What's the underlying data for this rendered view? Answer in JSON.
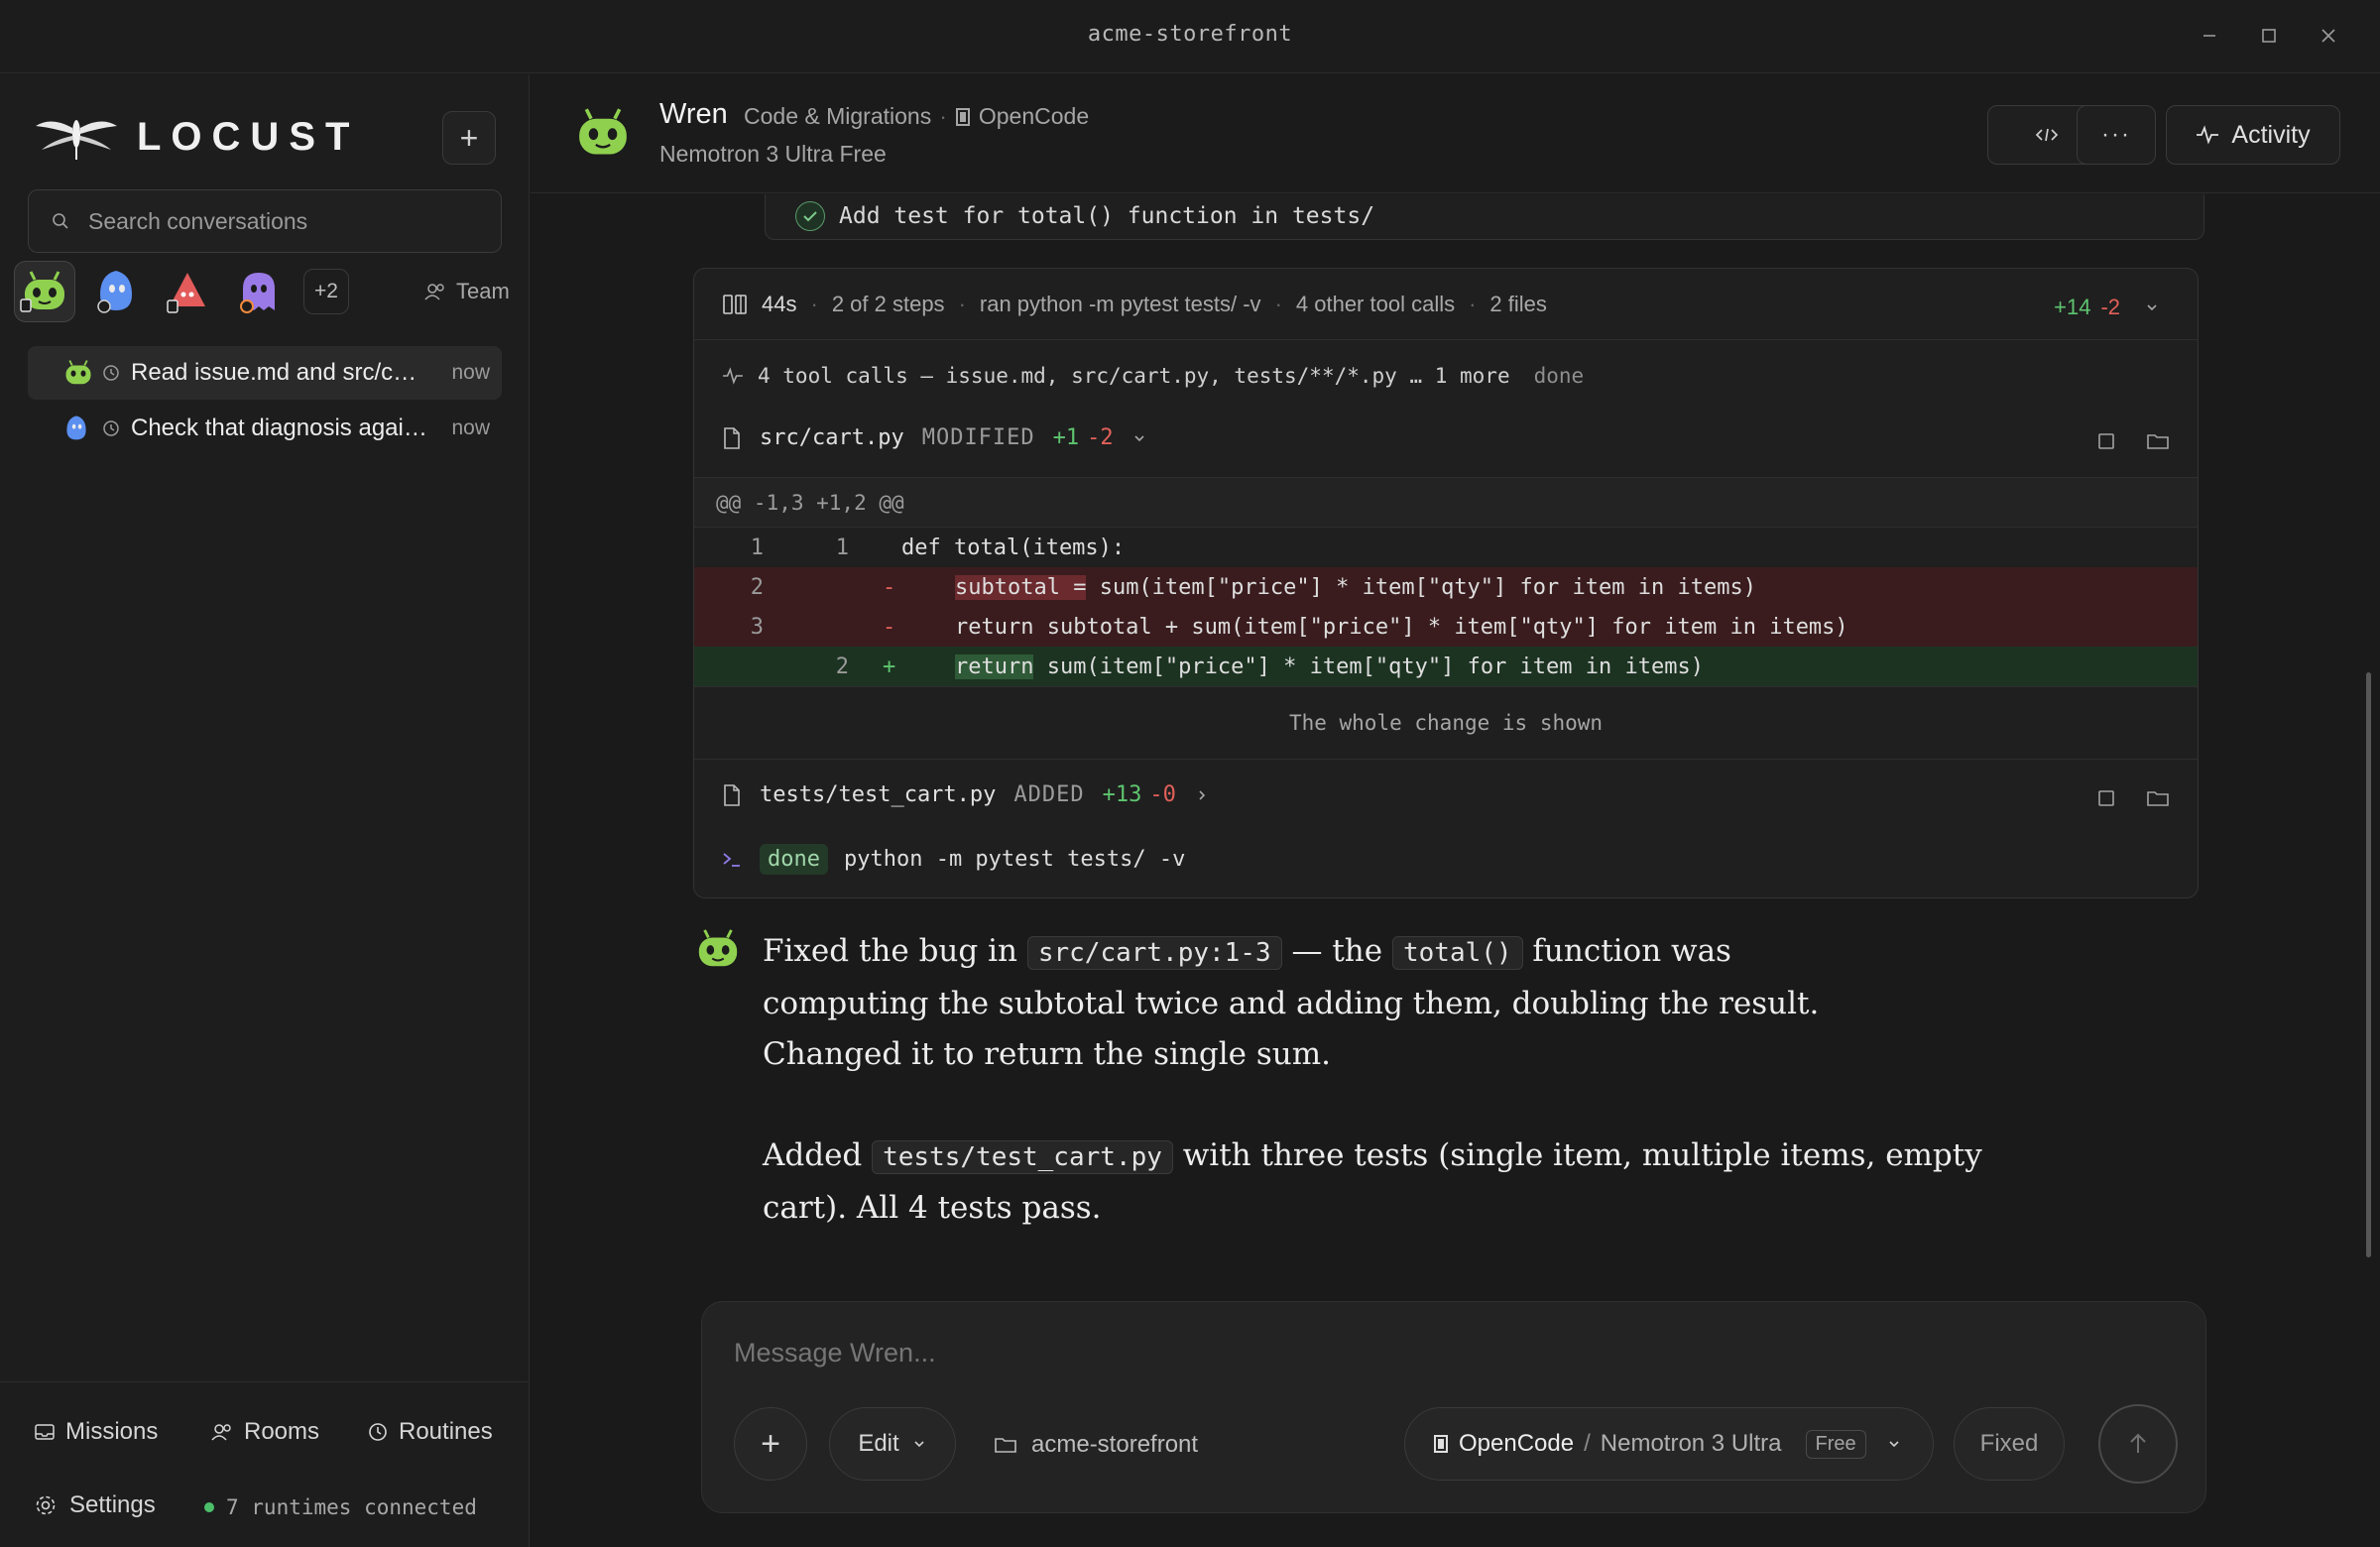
{
  "window": {
    "title": "acme-storefront"
  },
  "sidebar": {
    "logo_text": "LOCUST",
    "search_placeholder": "Search conversations",
    "agents_more": "+2",
    "team_label": "Team",
    "conversations": [
      {
        "label": "Read issue.md and src/cart.py",
        "time": "now"
      },
      {
        "label": "Check that diagnosis against",
        "time": "now"
      }
    ],
    "nav": {
      "missions": "Missions",
      "rooms": "Rooms",
      "routines": "Routines",
      "settings": "Settings"
    },
    "runtimes_status": "7 runtimes connected"
  },
  "header": {
    "agent_name": "Wren",
    "role": "Code & Migrations",
    "runtime": "OpenCode",
    "model": "Nemotron 3 Ultra Free",
    "activity_label": "Activity"
  },
  "chat": {
    "task_item": "Add test for total() function in tests/",
    "tool_summary": {
      "duration": "44s",
      "steps": "2 of 2 steps",
      "ran": "ran python -m pytest tests/ -v",
      "other_calls": "4 other tool calls",
      "files": "2 files",
      "additions": "+14",
      "deletions": "-2"
    },
    "tool_calls": {
      "text": "4 tool calls — issue.md, src/cart.py, tests/**/*.py … 1 more",
      "status": "done"
    },
    "file1": {
      "path": "src/cart.py",
      "state": "MODIFIED",
      "additions": "+1",
      "deletions": "-2"
    },
    "hunk_header": "@@ -1,3 +1,2 @@",
    "diff_lines": [
      {
        "old": "1",
        "new": "1",
        "sign": "",
        "code": "def total(items):"
      },
      {
        "old": "2",
        "new": "",
        "sign": "-",
        "hl": "subtotal =",
        "code": " sum(item[\"price\"] * item[\"qty\"] for item in items)"
      },
      {
        "old": "3",
        "new": "",
        "sign": "-",
        "code": "return subtotal + sum(item[\"price\"] * item[\"qty\"] for item in items)"
      },
      {
        "old": "",
        "new": "2",
        "sign": "+",
        "hl": "return",
        "code": " sum(item[\"price\"] * item[\"qty\"] for item in items)"
      }
    ],
    "whole_change": "The whole change is shown",
    "file2": {
      "path": "tests/test_cart.py",
      "state": "ADDED",
      "additions": "+13",
      "deletions": "-0"
    },
    "terminal": {
      "status": "done",
      "command": "python -m pytest tests/ -v"
    },
    "message": {
      "p1_a": "Fixed the bug in",
      "p1_code1": "src/cart.py:1-3",
      "p1_b": "— the",
      "p1_code2": "total()",
      "p1_c": "function was computing the subtotal twice and adding them, doubling the result. Changed it to return the single sum.",
      "p2_a": "Added",
      "p2_code": "tests/test_cart.py",
      "p2_b": "with three tests (single item, multiple items, empty cart). All 4 tests pass."
    }
  },
  "composer": {
    "placeholder": "Message Wren...",
    "mode": "Edit",
    "folder": "acme-storefront",
    "runtime": "OpenCode",
    "separator": "/",
    "model": "Nemotron 3 Ultra",
    "tag": "Free",
    "fixed_label": "Fixed"
  },
  "colors": {
    "add": "#5ec46f",
    "delete": "#e2605a",
    "robot": "#8fd14f"
  }
}
